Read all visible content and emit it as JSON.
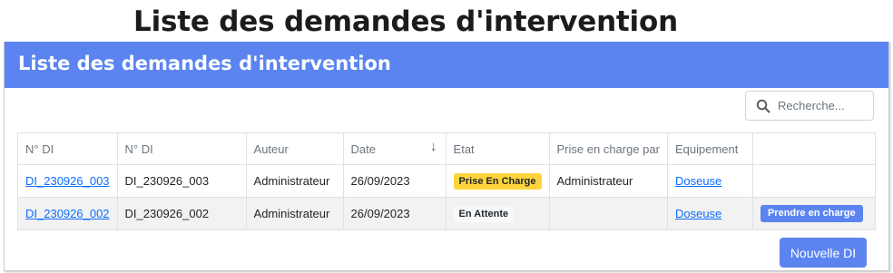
{
  "page": {
    "title": "Liste des demandes d'intervention"
  },
  "card": {
    "header": "Liste des demandes d'intervention"
  },
  "search": {
    "placeholder": "Recherche...",
    "value": "",
    "icon": "search-icon"
  },
  "table": {
    "columns": [
      "N° DI",
      "N° DI",
      "Auteur",
      "Date",
      "Etat",
      "Prise en charge par",
      "Equipement",
      ""
    ],
    "sort": {
      "column": "Date",
      "direction": "desc",
      "icon": "arrow-down"
    },
    "rows": [
      {
        "di_link": "DI_230926_003",
        "di_text": "DI_230926_003",
        "auteur": "Administrateur",
        "date": "26/09/2023",
        "etat": "Prise En Charge",
        "prise_par": "Administrateur",
        "equipement": "Doseuse",
        "action": ""
      },
      {
        "di_link": "DI_230926_002",
        "di_text": "DI_230926_002",
        "auteur": "Administrateur",
        "date": "26/09/2023",
        "etat": "En Attente",
        "prise_par": "",
        "equipement": "Doseuse",
        "action": "Prendre en charge"
      }
    ]
  },
  "actions": {
    "new_label": "Nouvelle DI"
  },
  "colors": {
    "primary": "#5b84f1",
    "badge_warning": "#ffd43b",
    "link": "#0d6efd"
  }
}
